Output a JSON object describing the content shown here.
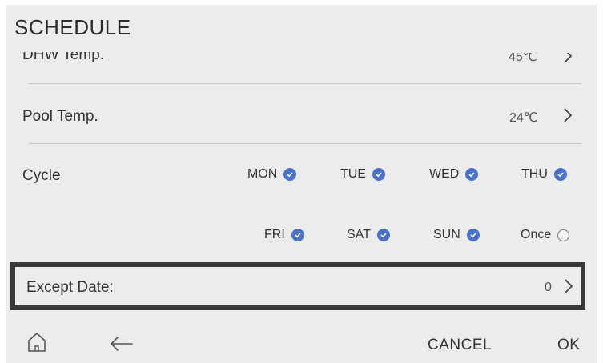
{
  "header": {
    "title": "SCHEDULE"
  },
  "rows": {
    "dhw": {
      "label": "DHW Temp.",
      "value": "45℃"
    },
    "pool": {
      "label": "Pool Temp.",
      "value": "24℃"
    },
    "cycle": {
      "label": "Cycle"
    },
    "except": {
      "label": "Except Date:",
      "value": "0"
    }
  },
  "cycle_days": [
    {
      "label": "MON",
      "checked": true
    },
    {
      "label": "TUE",
      "checked": true
    },
    {
      "label": "WED",
      "checked": true
    },
    {
      "label": "THU",
      "checked": true
    },
    {
      "label": "FRI",
      "checked": true
    },
    {
      "label": "SAT",
      "checked": true
    },
    {
      "label": "SUN",
      "checked": true
    },
    {
      "label": "Once",
      "checked": false
    }
  ],
  "footer": {
    "cancel_label": "CANCEL",
    "ok_label": "OK"
  },
  "colors": {
    "check_blue": "#4a72c8",
    "highlight_border": "#3a3a3a",
    "panel_bg": "#ececec"
  },
  "icons": {
    "home": "home-icon",
    "back": "back-arrow-icon",
    "chevron": "chevron-right-icon"
  }
}
